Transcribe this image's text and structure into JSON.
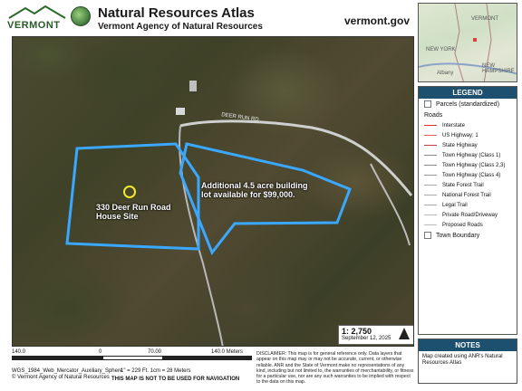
{
  "header": {
    "logo_text": "VERMONT",
    "title": "Natural Resources Atlas",
    "subtitle": "Vermont Agency of Natural Resources",
    "site": "vermont.gov"
  },
  "map": {
    "parcel_house_label": "330 Deer Run Road House Site",
    "parcel_lot_label": "Additional 4.5 acre building lot available for $99,000.",
    "road_label": "DEER RUN RD",
    "scale_ratio": "1: 2,750",
    "date": "September 12, 2025",
    "colors": {
      "parcel_outline": "#3aa8ff",
      "house_marker": "#f2ea2a",
      "road": "#cfcfcf"
    }
  },
  "locator": {
    "labels": [
      "VERMONT",
      "NEW YORK",
      "Albany",
      "NEW HAMPSHIRE"
    ]
  },
  "legend": {
    "heading": "LEGEND",
    "parcels": "Parcels (standardized)",
    "roads_heading": "Roads",
    "items": [
      {
        "label": "Interstate",
        "color": "#e03030"
      },
      {
        "label": "US Highway; 1",
        "color": "#e06060"
      },
      {
        "label": "State Highway",
        "color": "#c04040"
      },
      {
        "label": "Town Highway (Class 1)",
        "color": "#888888"
      },
      {
        "label": "Town Highway (Class 2,3)",
        "color": "#888888"
      },
      {
        "label": "Town Highway (Class 4)",
        "color": "#999999"
      },
      {
        "label": "State Forest Trail",
        "color": "#aaaaaa"
      },
      {
        "label": "National Forest Trail",
        "color": "#aaaaaa"
      },
      {
        "label": "Legal Trail",
        "color": "#aaaaaa"
      },
      {
        "label": "Private Road/Driveway",
        "color": "#bbbbbb"
      },
      {
        "label": "Proposed Roads",
        "color": "#bbbbbb"
      }
    ],
    "town_boundary": "Town Boundary"
  },
  "notes": {
    "heading": "NOTES",
    "text": "Map created using ANR's Natural Resources Atlas"
  },
  "footer": {
    "scale_labels": [
      "140.0",
      "0",
      "70.00",
      "140.0 Meters"
    ],
    "projection": "WGS_1984_Web_Mercator_Auxiliary_Sphere",
    "units": "1\" = 229 Ft. 1cm = 28 Meters",
    "copyright": "© Vermont Agency of Natural Resources",
    "no_nav": "THIS MAP IS NOT TO BE USED FOR NAVIGATION",
    "disclaimer": "DISCLAIMER: This map is for general reference only. Data layers that appear on this map may or may not be accurate, current, or otherwise reliable. ANR and the State of Vermont make no representations of any kind, including but not limited to, the warranties of merchantability, or fitness for a particular use, nor are any such warranties to be implied with respect to the data on this map."
  }
}
